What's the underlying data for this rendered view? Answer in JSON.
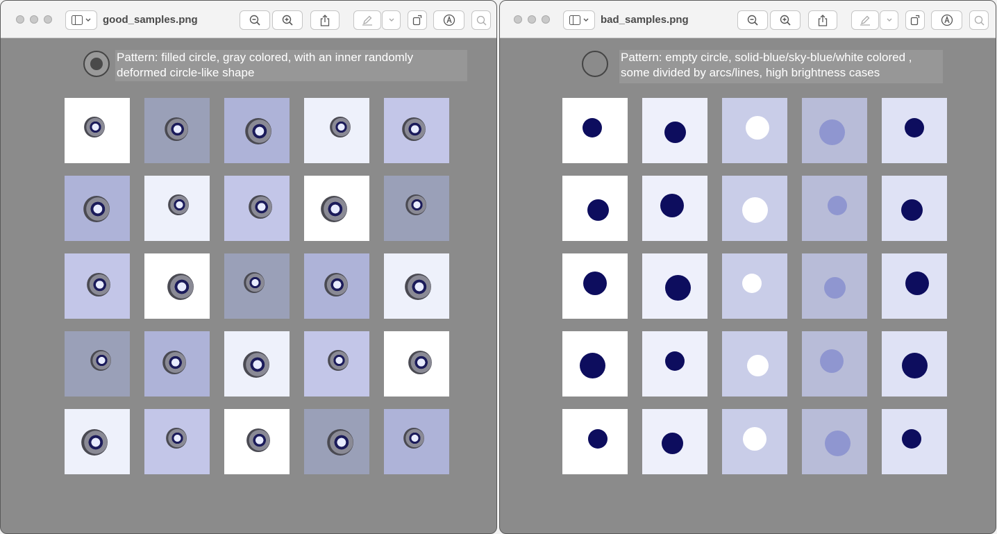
{
  "windows": {
    "left": {
      "title": "good_samples.png",
      "pattern": {
        "line1": "Pattern: filled circle, gray colored, with an inner randomly",
        "line2": "deformed circle-like shape"
      },
      "icon": "filled-circle-icon"
    },
    "right": {
      "title": "bad_samples.png",
      "pattern": {
        "line1": "Pattern: empty circle, solid-blue/sky-blue/white colored ,",
        "line2": "some divided by arcs/lines, high brightness cases"
      },
      "icon": "empty-circle-icon"
    }
  },
  "toolbar_icons": [
    "sidebar-icon",
    "chevron-down-icon",
    "zoom-out-icon",
    "zoom-in-icon",
    "share-icon",
    "pen-markup-icon",
    "chevron-down-icon",
    "rotate-icon",
    "markup-icon",
    "search-icon"
  ],
  "colors": {
    "window_bg": "#8b8b8b",
    "toolbar_bg": "#f3f3f3",
    "label_bg": "#979797",
    "good_tile_bg": "#b8bde0",
    "good_ring": "#4a4a52",
    "bad_tile_bg": "#e3e6f6",
    "bad_dot": "#0d0d5e"
  },
  "grid": {
    "rows": 5,
    "cols": 5
  }
}
